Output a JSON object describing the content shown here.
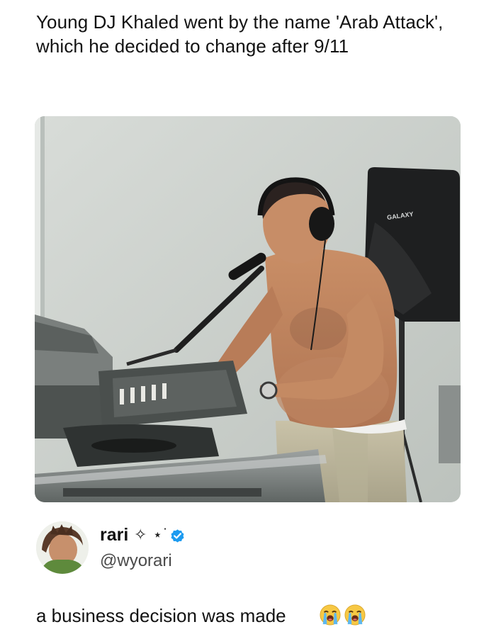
{
  "post": {
    "text": "Young DJ Khaled went by the name 'Arab Attack', which he decided to change after 9/11"
  },
  "photo": {
    "speaker_brand": "GALAXY"
  },
  "author": {
    "display_name": "rari",
    "name_decoration": "✧ ⋆˙",
    "handle": "@wyorari",
    "verified": true,
    "verified_color": "#1d9bf0"
  },
  "reply": {
    "text": "a business decision was made",
    "emojis": [
      "loudly-crying-face-emoji",
      "loudly-crying-face-emoji"
    ]
  }
}
